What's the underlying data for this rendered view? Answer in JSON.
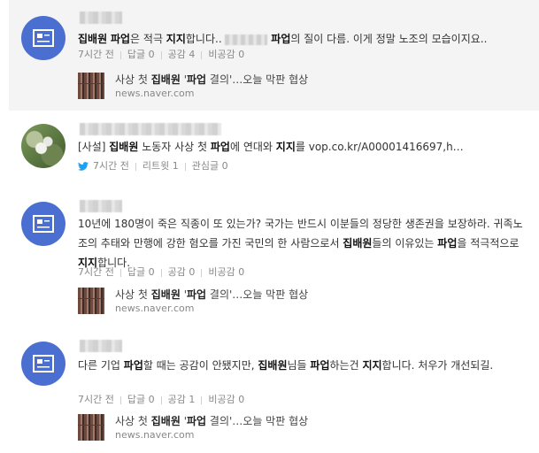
{
  "posts": [
    {
      "author_blurred": true,
      "text_parts": [
        {
          "t": "집배원",
          "b": true
        },
        {
          "t": " "
        },
        {
          "t": "파업",
          "b": true
        },
        {
          "t": "은 적극 "
        },
        {
          "t": "지지",
          "b": true
        },
        {
          "t": "합니다.. "
        },
        {
          "blur": true
        },
        {
          "t": " "
        },
        {
          "t": "파업",
          "b": true
        },
        {
          "t": "의 질이 다름. 이게 정말 노조의 모습이지요.."
        }
      ],
      "time": "7시간 전",
      "reply_label": "답글",
      "reply_count": "0",
      "like_label": "공감",
      "like_count": "4",
      "dislike_label": "비공감",
      "dislike_count": "0",
      "link": {
        "title_parts": [
          {
            "t": "사상 첫 "
          },
          {
            "t": "집배원",
            "b": true
          },
          {
            "t": " '"
          },
          {
            "t": "파업",
            "b": true
          },
          {
            "t": " 결의'…오늘 막판 협상"
          }
        ],
        "source": "news.naver.com"
      }
    },
    {
      "author_blurred": true,
      "text_parts": [
        {
          "t": "[사설] "
        },
        {
          "t": "집배원",
          "b": true
        },
        {
          "t": " 노동자 사상 첫 "
        },
        {
          "t": "파업",
          "b": true
        },
        {
          "t": "에 연대와 "
        },
        {
          "t": "지지",
          "b": true
        },
        {
          "t": "를 vop.co.kr/A00001416697,h…"
        }
      ],
      "time": "7시간 전",
      "retweet_label": "리트윗",
      "retweet_count": "1",
      "interest_label": "관심글",
      "interest_count": "0"
    },
    {
      "author_blurred": true,
      "text_parts": [
        {
          "t": "10년에 180명이 죽은 직종이 또 있는가? 국가는 반드시 이분들의 정당한 생존권을 보장하라. 귀족노조의 추태와 만행에 강한 혐오를 가진 국민의 한 사람으로서 "
        },
        {
          "t": "집배원",
          "b": true
        },
        {
          "t": "들의 이유있는 "
        },
        {
          "t": "파업",
          "b": true
        },
        {
          "t": "을 적극적으로 "
        },
        {
          "t": "지지",
          "b": true
        },
        {
          "t": "합니다."
        }
      ],
      "time": "7시간 전",
      "reply_label": "답글",
      "reply_count": "0",
      "like_label": "공감",
      "like_count": "0",
      "dislike_label": "비공감",
      "dislike_count": "0",
      "link": {
        "title_parts": [
          {
            "t": "사상 첫 "
          },
          {
            "t": "집배원",
            "b": true
          },
          {
            "t": " '"
          },
          {
            "t": "파업",
            "b": true
          },
          {
            "t": " 결의'…오늘 막판 협상"
          }
        ],
        "source": "news.naver.com"
      }
    },
    {
      "author_blurred": true,
      "text_parts": [
        {
          "t": "다른 기업 "
        },
        {
          "t": "파업",
          "b": true
        },
        {
          "t": "할 때는 공감이 안됐지만, "
        },
        {
          "t": "집배원",
          "b": true
        },
        {
          "t": "님들 "
        },
        {
          "t": "파업",
          "b": true
        },
        {
          "t": "하는건 "
        },
        {
          "t": "지지",
          "b": true
        },
        {
          "t": "합니다. 처우가 개선되길."
        }
      ],
      "time": "7시간 전",
      "reply_label": "답글",
      "reply_count": "0",
      "like_label": "공감",
      "like_count": "1",
      "dislike_label": "비공감",
      "dislike_count": "0",
      "link": {
        "title_parts": [
          {
            "t": "사상 첫 "
          },
          {
            "t": "집배원",
            "b": true
          },
          {
            "t": " '"
          },
          {
            "t": "파업",
            "b": true
          },
          {
            "t": " 결의'…오늘 막판 협상"
          }
        ],
        "source": "news.naver.com"
      }
    }
  ],
  "colors": {
    "avatar_blue": "#4a6fd1",
    "highlight_bg": "#f4f4f4",
    "twitter_blue": "#1da1f2"
  },
  "icons": {
    "avatar": "news-avatar-icon",
    "twitter": "twitter-bird-icon"
  }
}
